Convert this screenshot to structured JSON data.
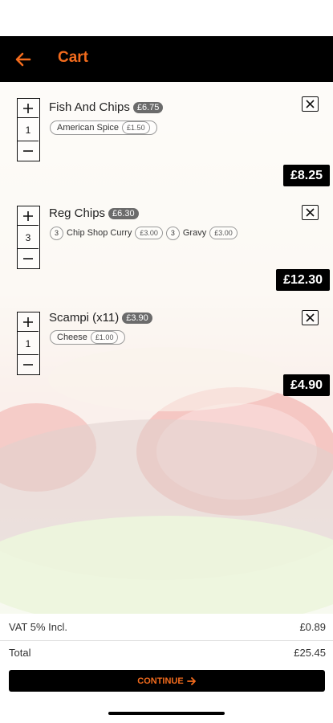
{
  "header": {
    "title": "Cart",
    "back_icon": "arrow-left-icon",
    "accent": "#f26b1d"
  },
  "items": [
    {
      "name": "Fish And Chips",
      "unit_price": "£6.75",
      "qty": "1",
      "options": [
        {
          "name": "American Spice",
          "price": "£1.50"
        }
      ],
      "total": "£8.25"
    },
    {
      "name": "Reg Chips",
      "unit_price": "£6.30",
      "qty": "3",
      "options": [
        {
          "qty": "3",
          "name": "Chip Shop Curry",
          "price": "£3.00"
        },
        {
          "qty": "3",
          "name": "Gravy",
          "price": "£3.00"
        }
      ],
      "total": "£12.30"
    },
    {
      "name": "Scampi (x11)",
      "unit_price": "£3.90",
      "qty": "1",
      "options": [
        {
          "name": "Cheese",
          "price": "£1.00"
        }
      ],
      "total": "£4.90"
    }
  ],
  "summary": {
    "vat_label": "VAT 5% Incl.",
    "vat_value": "£0.89",
    "total_label": "Total",
    "total_value": "£25.45"
  },
  "continue_label": "CONTINUE"
}
